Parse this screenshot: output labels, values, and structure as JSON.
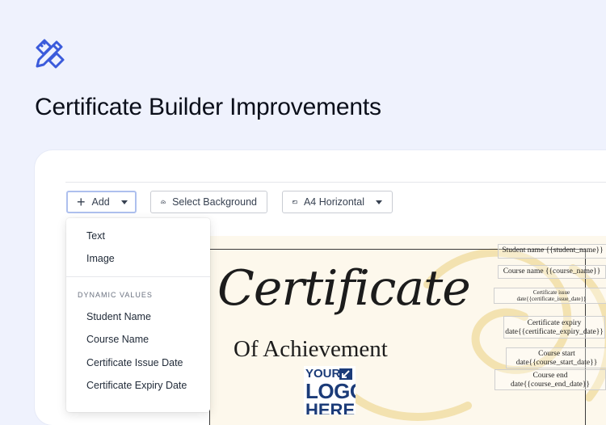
{
  "hero": {
    "icon": "pencil-ruler-icon",
    "title": "Certificate Builder Improvements"
  },
  "colors": {
    "page_background": "#eff2fd",
    "accent": "#3b5bdb",
    "canvas_background": "#fdf8ec"
  },
  "toolbar": {
    "add_label": "Add",
    "background_label": "Select Background",
    "page_size_label": "A4 Horizontal"
  },
  "add_menu": {
    "items": [
      "Text",
      "Image"
    ],
    "dynamic_values_heading": "DYNAMIC VALUES",
    "dynamic_values": [
      "Student Name",
      "Course Name",
      "Certificate Issue Date",
      "Certificate Expiry Date"
    ]
  },
  "certificate": {
    "title": "Certificate",
    "subtitle": "Of Achievement",
    "logo_lines": [
      "YOUR",
      "LOGO",
      "HERE"
    ],
    "fields": {
      "student_name": "Student name {{student_name}}",
      "course_name": "Course name {{course_name}}",
      "issue_date_label": "Certificate issue",
      "issue_date_value": "date{{certificate_issue_date}}",
      "expiry_date_label": "Certificate expiry",
      "expiry_date_value": "date{{certificate_expiry_date}}",
      "start_date_label": "Course start",
      "start_date_value": "date{{course_start_date}}",
      "end_date_label": "Course end",
      "end_date_value": "date{{course_end_date}}"
    }
  }
}
